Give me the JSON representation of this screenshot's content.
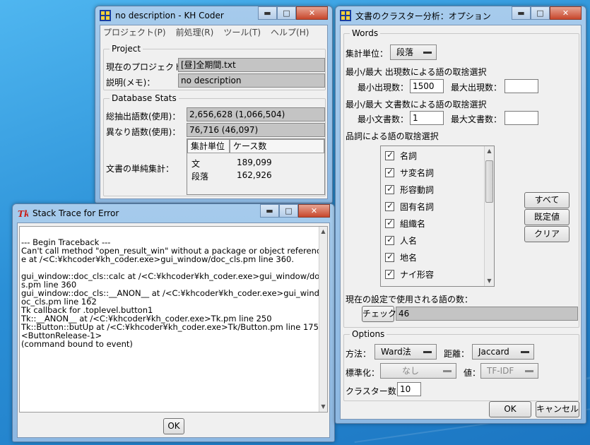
{
  "kh_window": {
    "title": "no description - KH Coder",
    "menus": [
      "プロジェクト(P)",
      "前処理(R)",
      "ツール(T)",
      "ヘルプ(H)"
    ],
    "project": {
      "legend": "Project",
      "current_label": "現在のプロジェクト：",
      "current_value": "[昼]全期間.txt",
      "desc_label": "説明(メモ)：",
      "desc_value": "no description"
    },
    "stats": {
      "legend": "Database Stats",
      "total_label": "総抽出語数(使用)：",
      "total_value": "2,656,628 (1,066,504)",
      "distinct_label": "異なり語数(使用)：",
      "distinct_value": "76,716 (46,097)",
      "simple_label": "文書の単純集計：",
      "table_headers": [
        "集計単位",
        "ケース数"
      ],
      "rows": [
        {
          "unit": "文",
          "count": "189,099"
        },
        {
          "unit": "段落",
          "count": "162,926"
        }
      ]
    }
  },
  "stack_window": {
    "title": "Stack Trace for Error",
    "icon": "tk-icon",
    "trace_lines": [
      "--- Begin Traceback ---",
      "Can't call method \"open_result_win\" without a package or object referenc",
      "e at /<C:¥khcoder¥kh_coder.exe>gui_window/doc_cls.pm line 360.",
      "",
      "gui_window::doc_cls::calc at /<C:¥khcoder¥kh_coder.exe>gui_window/doc_cl",
      "s.pm line 360",
      "gui_window::doc_cls::__ANON__ at /<C:¥khcoder¥kh_coder.exe>gui_window/d",
      "oc_cls.pm line 162",
      "Tk callback for .toplevel.button1",
      "Tk::__ANON__ at /<C:¥khcoder¥kh_coder.exe>Tk.pm line 250",
      "Tk::Button::butUp at /<C:¥khcoder¥kh_coder.exe>Tk/Button.pm line 175",
      "<ButtonRelease-1>",
      "(command bound to event)"
    ],
    "ok_label": "OK"
  },
  "cluster_window": {
    "title": "文書のクラスター分析：オプション",
    "words": {
      "legend": "Words",
      "unit_label": "集計単位：",
      "unit_value": "段落",
      "freq_heading": "最小/最大 出現数による語の取捨選択",
      "min_freq_label": "最小出現数：",
      "min_freq_value": "1500",
      "max_freq_label": "最大出現数：",
      "max_freq_value": "",
      "doc_heading": "最小/最大 文書数による語の取捨選択",
      "min_doc_label": "最小文書数：",
      "min_doc_value": "1",
      "max_doc_label": "最大文書数：",
      "max_doc_value": "",
      "pos_heading": "品詞による語の取捨選択",
      "pos_items": [
        "名詞",
        "サ変名詞",
        "形容動詞",
        "固有名詞",
        "組織名",
        "人名",
        "地名",
        "ナイ形容"
      ],
      "btn_all": "すべて",
      "btn_default": "既定値",
      "btn_clear": "クリア",
      "count_label": "現在の設定で使用される語の数：",
      "check_label": "チェック",
      "count_value": "46"
    },
    "options": {
      "legend": "Options",
      "method_label": "方法：",
      "method_value": "Ward法",
      "distance_label": "距離：",
      "distance_value": "Jaccard",
      "standardize_label": "標準化：",
      "standardize_value": "なし",
      "value_label": "値：",
      "value_value": "TF-IDF",
      "clusters_label": "クラスター数：",
      "clusters_value": "10"
    },
    "ok_label": "OK",
    "cancel_label": "キャンセル"
  }
}
